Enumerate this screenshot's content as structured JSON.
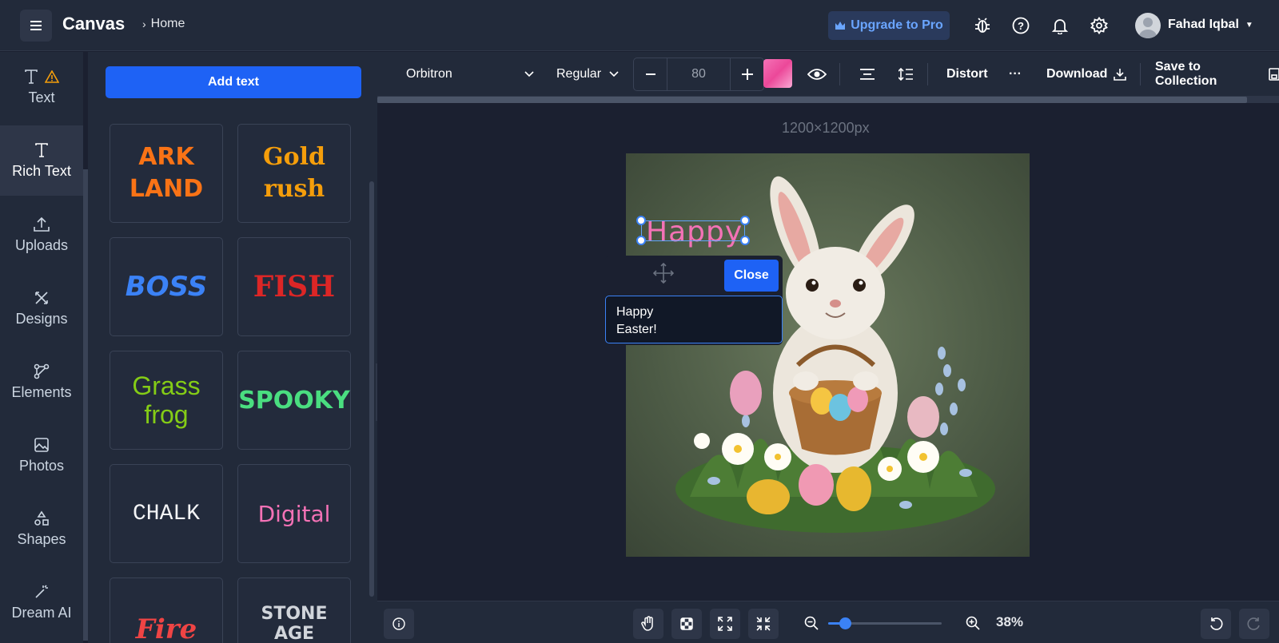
{
  "header": {
    "app_title": "Canvas",
    "breadcrumb": "Home",
    "upgrade_label": "Upgrade to Pro",
    "user_name": "Fahad Iqbal"
  },
  "rail": {
    "items": [
      {
        "label": "Text",
        "icon": "text-icon"
      },
      {
        "label": "Rich Text",
        "icon": "text-icon"
      },
      {
        "label": "Uploads",
        "icon": "upload-icon"
      },
      {
        "label": "Designs",
        "icon": "designs-icon"
      },
      {
        "label": "Elements",
        "icon": "elements-icon"
      },
      {
        "label": "Photos",
        "icon": "photo-icon"
      },
      {
        "label": "Shapes",
        "icon": "shapes-icon"
      },
      {
        "label": "Dream AI",
        "icon": "magic-wand-icon"
      }
    ]
  },
  "panel": {
    "add_text_label": "Add text",
    "tiles": [
      {
        "line1": "ARK",
        "line2": "LAND",
        "color": "#f97316"
      },
      {
        "line1": "Gold",
        "line2": "rush",
        "color": "#f59e0b"
      },
      {
        "line1": "BOSS",
        "line2": "",
        "color": "#3b82f6"
      },
      {
        "line1": "FISH",
        "line2": "",
        "color": "#dc2626"
      },
      {
        "line1": "Grass",
        "line2": "frog",
        "color": "#84cc16"
      },
      {
        "line1": "SPOOKY",
        "line2": "",
        "color": "#4ade80"
      },
      {
        "line1": "CHALK",
        "line2": "",
        "color": "#f3f4f6"
      },
      {
        "line1": "Digital",
        "line2": "",
        "color": "#f472b6"
      },
      {
        "line1": "Fire",
        "line2": "",
        "color": "#ef4444"
      },
      {
        "line1": "STONE AGE",
        "line2": "",
        "color": "#d1d5db"
      }
    ]
  },
  "toolbar": {
    "font_family": "Orbitron",
    "font_weight": "Regular",
    "font_size": "80",
    "distort_label": "Distort",
    "more_label": "···",
    "download_label": "Download",
    "save_label": "Save to Collection"
  },
  "canvas": {
    "dimensions": "1200×1200px",
    "selected_text": "Happy",
    "popover_close": "Close",
    "textarea_line1": "Happy",
    "textarea_line2": "Easter!"
  },
  "bottom": {
    "zoom_label": "38%",
    "zoom_fraction": 0.15
  },
  "colors": {
    "accent": "#1e62f5",
    "text_color": "#f472b6"
  }
}
